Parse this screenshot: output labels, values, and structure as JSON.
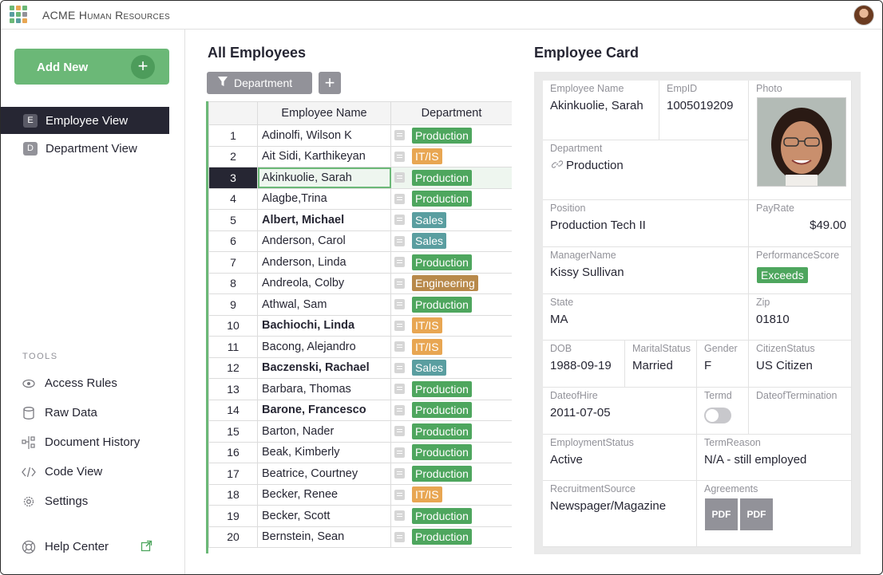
{
  "app": {
    "title": "ACME Human Resources"
  },
  "sidebar": {
    "add_new": "Add New",
    "add_icon": "plus-icon",
    "views": [
      {
        "badge": "E",
        "label": "Employee View",
        "active": true
      },
      {
        "badge": "D",
        "label": "Department View",
        "active": false
      }
    ],
    "tools_heading": "TOOLS",
    "tools": [
      {
        "icon": "eye-icon",
        "label": "Access Rules"
      },
      {
        "icon": "database-icon",
        "label": "Raw Data"
      },
      {
        "icon": "history-icon",
        "label": "Document History"
      },
      {
        "icon": "code-icon",
        "label": "Code View"
      },
      {
        "icon": "gear-icon",
        "label": "Settings"
      }
    ],
    "help": {
      "icon": "lifebuoy-icon",
      "label": "Help Center"
    }
  },
  "employees_section": {
    "title": "All Employees",
    "filter_label": "Department",
    "columns": {
      "name": "Employee Name",
      "department": "Department"
    },
    "selected_row": 3,
    "rows": [
      {
        "n": "1",
        "name": "Adinolfi, Wilson  K",
        "bold": false,
        "dept": "Production"
      },
      {
        "n": "2",
        "name": "Ait Sidi, Karthikeyan",
        "bold": false,
        "dept": "IT/IS"
      },
      {
        "n": "3",
        "name": "Akinkuolie, Sarah",
        "bold": false,
        "dept": "Production"
      },
      {
        "n": "4",
        "name": "Alagbe,Trina",
        "bold": false,
        "dept": "Production"
      },
      {
        "n": "5",
        "name": "Albert, Michael",
        "bold": true,
        "dept": "Sales"
      },
      {
        "n": "6",
        "name": "Anderson, Carol",
        "bold": false,
        "dept": "Sales"
      },
      {
        "n": "7",
        "name": "Anderson, Linda",
        "bold": false,
        "dept": "Production"
      },
      {
        "n": "8",
        "name": "Andreola, Colby",
        "bold": false,
        "dept": "Engineering"
      },
      {
        "n": "9",
        "name": "Athwal, Sam",
        "bold": false,
        "dept": "Production"
      },
      {
        "n": "10",
        "name": "Bachiochi, Linda",
        "bold": true,
        "dept": "IT/IS"
      },
      {
        "n": "11",
        "name": "Bacong, Alejandro",
        "bold": false,
        "dept": "IT/IS"
      },
      {
        "n": "12",
        "name": "Baczenski, Rachael",
        "bold": true,
        "dept": "Sales"
      },
      {
        "n": "13",
        "name": "Barbara, Thomas",
        "bold": false,
        "dept": "Production"
      },
      {
        "n": "14",
        "name": "Barone, Francesco",
        "bold": true,
        "dept": "Production"
      },
      {
        "n": "15",
        "name": "Barton, Nader",
        "bold": false,
        "dept": "Production"
      },
      {
        "n": "16",
        "name": "Beak, Kimberly",
        "bold": false,
        "dept": "Production"
      },
      {
        "n": "17",
        "name": "Beatrice, Courtney",
        "bold": false,
        "dept": "Production"
      },
      {
        "n": "18",
        "name": "Becker, Renee",
        "bold": false,
        "dept": "IT/IS"
      },
      {
        "n": "19",
        "name": "Becker, Scott",
        "bold": false,
        "dept": "Production"
      },
      {
        "n": "20",
        "name": "Bernstein, Sean",
        "bold": false,
        "dept": "Production"
      }
    ]
  },
  "dept_colors": {
    "Production": "#4ea65e",
    "IT/IS": "#e8a652",
    "Sales": "#5a9ea0",
    "Engineering": "#b8894a"
  },
  "card": {
    "title": "Employee Card",
    "employee_name": {
      "label": "Employee Name",
      "value": "Akinkuolie, Sarah"
    },
    "emp_id": {
      "label": "EmpID",
      "value": "1005019209"
    },
    "photo": {
      "label": "Photo"
    },
    "department": {
      "label": "Department",
      "value": "Production"
    },
    "position": {
      "label": "Position",
      "value": "Production Tech II"
    },
    "pay_rate": {
      "label": "PayRate",
      "value": "$49.00"
    },
    "manager": {
      "label": "ManagerName",
      "value": "Kissy Sullivan"
    },
    "performance": {
      "label": "PerformanceScore",
      "value": "Exceeds"
    },
    "state": {
      "label": "State",
      "value": "MA"
    },
    "zip": {
      "label": "Zip",
      "value": "01810"
    },
    "dob": {
      "label": "DOB",
      "value": "1988-09-19"
    },
    "marital": {
      "label": "MaritalStatus",
      "value": "Married"
    },
    "gender": {
      "label": "Gender",
      "value": "F"
    },
    "citizen": {
      "label": "CitizenStatus",
      "value": "US Citizen"
    },
    "hire": {
      "label": "DateofHire",
      "value": "2011-07-05"
    },
    "termd": {
      "label": "Termd",
      "value": false
    },
    "term_date": {
      "label": "DateofTermination",
      "value": ""
    },
    "emp_status": {
      "label": "EmploymentStatus",
      "value": "Active"
    },
    "term_reason": {
      "label": "TermReason",
      "value": "N/A - still employed"
    },
    "recruit": {
      "label": "RecruitmentSource",
      "value": "Newspager/Magazine"
    },
    "agreements": {
      "label": "Agreements",
      "files": [
        "PDF",
        "PDF"
      ]
    }
  }
}
